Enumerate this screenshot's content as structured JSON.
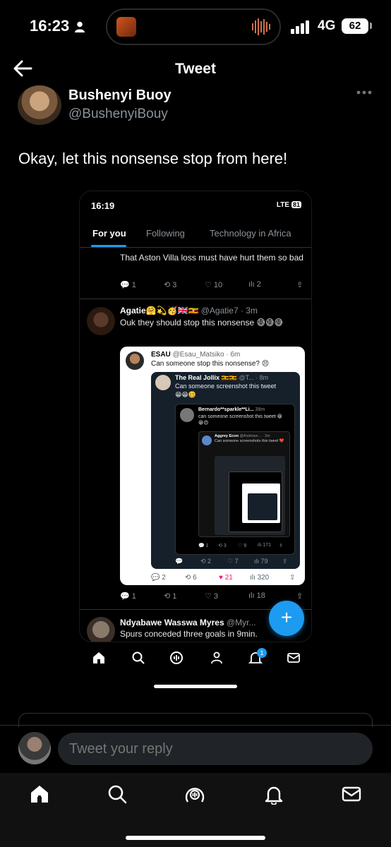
{
  "status_bar": {
    "time": "16:23",
    "network": "4G",
    "battery": "62"
  },
  "header": {
    "title": "Tweet"
  },
  "tweet": {
    "author_name": "Bushenyi Buoy",
    "author_handle": "@BushenyiBouy",
    "text": "Okay, let this nonsense stop from here!"
  },
  "screenshot": {
    "status_time": "16:19",
    "status_network": "LTE",
    "status_battery": "81",
    "tabs": [
      "For you",
      "Following",
      "Technology in Africa"
    ],
    "post1": {
      "text": "That Aston Villa loss must have hurt them so bad",
      "replies": "1",
      "retweets": "3",
      "likes": "10",
      "views": "2"
    },
    "post2": {
      "name": "Agatie🤗💫🥳🇬🇧🇺🇬",
      "handle": "@Agatie7 · 3m",
      "text": "Ouk they should stop this nonsense 😅😅😅",
      "replies": "1",
      "retweets": "1",
      "likes": "3",
      "views": "18"
    },
    "quote1": {
      "name": "ESAU",
      "handle": "@Esau_Matsiko · 6m",
      "text": "Can someone stop this nonsense? 😣",
      "replies": "2",
      "retweets": "6",
      "likes": "21",
      "views": "320"
    },
    "quote2": {
      "name": "The Real Jollix 🇺🇬🇺🇬",
      "handle": "@T... · 8m",
      "text": "Can someone screenshot this tweet 😁😁🥴",
      "retweets": "2",
      "likes": "7",
      "views": "79"
    },
    "quote3": {
      "name": "Bernardo**sparkle**Li...",
      "handle": "38m",
      "text": "can someone screenshot this tweet 😁😁😍",
      "replies": "1",
      "retweets": "3",
      "likes": "9",
      "views": "171"
    },
    "quote4": {
      "name": "Aggrey Econ",
      "handle": "@Asiimwe... · 2m",
      "text": "Can someone screenshots this tweet ❤️"
    },
    "post3": {
      "name": "Ndyabawe Wasswa Myres",
      "handle": "@Myr...",
      "text": "Spurs conceded three goals in 9min."
    },
    "fab": "+",
    "notif_count": "1"
  },
  "reply": {
    "placeholder": "Tweet your reply"
  },
  "colors": {
    "accent": "#1d9bf0",
    "like": "#f91880"
  },
  "icons": [
    "back-arrow-icon",
    "more-icon",
    "home-icon",
    "search-icon",
    "spaces-icon",
    "notifications-icon",
    "messages-icon",
    "communities-icon"
  ]
}
